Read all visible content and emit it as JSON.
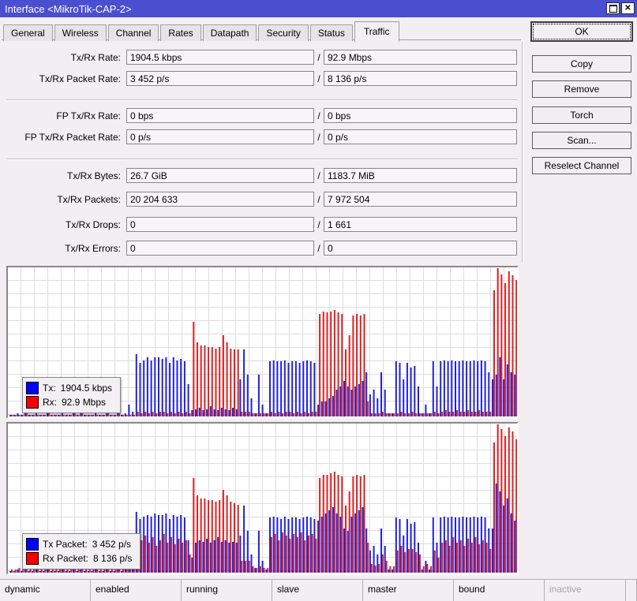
{
  "window": {
    "title": "Interface <MikroTik-CAP-2>"
  },
  "titlebar": {
    "buttons": [
      {
        "name": "maximize",
        "glyph": "max"
      },
      {
        "name": "close",
        "glyph": "x"
      }
    ]
  },
  "tabs": {
    "items": [
      "General",
      "Wireless",
      "Channel",
      "Rates",
      "Datapath",
      "Security",
      "Status",
      "Traffic"
    ],
    "active": "Traffic"
  },
  "fields": {
    "slash": "/",
    "rows": [
      {
        "id": "tx-rx-rate",
        "label": "Tx/Rx Rate:",
        "tx": "1904.5 kbps",
        "rx": "92.9 Mbps"
      },
      {
        "id": "tx-rx-packet-rate",
        "label": "Tx/Rx Packet Rate:",
        "tx": "3 452 p/s",
        "rx": "8 136 p/s"
      },
      {
        "id": "fp-tx-rx-rate",
        "label": "FP Tx/Rx Rate:",
        "tx": "0 bps",
        "rx": "0 bps"
      },
      {
        "id": "fp-tx-rx-packet-rate",
        "label": "FP Tx/Rx Packet Rate:",
        "tx": "0 p/s",
        "rx": "0 p/s"
      },
      {
        "id": "tx-rx-bytes",
        "label": "Tx/Rx Bytes:",
        "tx": "26.7 GiB",
        "rx": "1183.7 MiB"
      },
      {
        "id": "tx-rx-packets",
        "label": "Tx/Rx Packets:",
        "tx": "20 204 633",
        "rx": "7 972 504"
      },
      {
        "id": "tx-rx-drops",
        "label": "Tx/Rx Drops:",
        "tx": "0",
        "rx": "1 661"
      },
      {
        "id": "tx-rx-errors",
        "label": "Tx/Rx Errors:",
        "tx": "0",
        "rx": "0"
      }
    ]
  },
  "buttons": [
    {
      "id": "ok-button",
      "label": "OK",
      "default": true
    },
    {
      "id": "copy-button",
      "label": "Copy"
    },
    {
      "id": "remove-button",
      "label": "Remove"
    },
    {
      "id": "torch-button",
      "label": "Torch"
    },
    {
      "id": "scan-button",
      "label": "Scan..."
    },
    {
      "id": "reselect-channel-button",
      "label": "Reselect Channel"
    }
  ],
  "status_bar": {
    "items": [
      {
        "label": "dynamic",
        "muted": false
      },
      {
        "label": "enabled",
        "muted": false
      },
      {
        "label": "running",
        "muted": false
      },
      {
        "label": "slave",
        "muted": false
      },
      {
        "label": "master",
        "muted": false
      },
      {
        "label": "bound",
        "muted": false
      },
      {
        "label": "inactive",
        "muted": true
      }
    ]
  },
  "colors": {
    "titlebar": "#4a4fd0",
    "tx_bar": "#2222dd",
    "rx_bar": "#dd2222",
    "tx_swatch": "#0000f8",
    "rx_swatch": "#f80000"
  },
  "chart_data": [
    {
      "type": "bar",
      "name": "tx-rx-rate-graph",
      "title": "Traffic rate history (Tx blue / Rx red)",
      "ylim": [
        0,
        100
      ],
      "y_unit": "percent of plot height (no axis labels shown)",
      "grid": true,
      "legend_position": "bottom-left",
      "legend": [
        {
          "name": "tx",
          "label": "Tx:",
          "value": "1904.5 kbps",
          "color": "#0000f8"
        },
        {
          "name": "rx",
          "label": "Rx:",
          "value": "92.9 Mbps",
          "color": "#f80000"
        }
      ],
      "series": [
        {
          "name": "Tx",
          "color": "#2222dd",
          "values": [
            1,
            1,
            2,
            1,
            22,
            1,
            1,
            2,
            1,
            1,
            20,
            1,
            1,
            1,
            2,
            1,
            1,
            15,
            1,
            21,
            1,
            1,
            1,
            2,
            1,
            1,
            19,
            1,
            1,
            25,
            1,
            2,
            8,
            3,
            42,
            36,
            38,
            40,
            38,
            40,
            40,
            39,
            40,
            36,
            40,
            38,
            39,
            37,
            22,
            4,
            5,
            6,
            4,
            5,
            7,
            5,
            4,
            6,
            5,
            4,
            6,
            5,
            25,
            45,
            28,
            12,
            2,
            28,
            8,
            2,
            37,
            38,
            37,
            37,
            38,
            36,
            37,
            37,
            36,
            37,
            38,
            37,
            36,
            8,
            10,
            10,
            12,
            14,
            18,
            20,
            24,
            20,
            18,
            20,
            22,
            24,
            30,
            15,
            18,
            12,
            30,
            18,
            2,
            2,
            37,
            36,
            25,
            36,
            33,
            34,
            20,
            2,
            8,
            2,
            37,
            20,
            37,
            38,
            37,
            38,
            37,
            37,
            38,
            37,
            37,
            38,
            37,
            38,
            37,
            30,
            25,
            28,
            40,
            25,
            35,
            30,
            28
          ]
        },
        {
          "name": "Rx",
          "color": "#dd2222",
          "values": [
            1,
            1,
            1,
            1,
            2,
            1,
            1,
            1,
            1,
            1,
            2,
            1,
            1,
            1,
            1,
            1,
            1,
            2,
            1,
            2,
            1,
            1,
            1,
            1,
            1,
            1,
            2,
            1,
            1,
            2,
            1,
            1,
            1,
            1,
            3,
            2,
            3,
            2,
            3,
            2,
            3,
            3,
            2,
            3,
            2,
            3,
            2,
            3,
            2,
            64,
            50,
            48,
            48,
            47,
            47,
            46,
            47,
            55,
            50,
            46,
            45,
            45,
            3,
            3,
            3,
            2,
            2,
            2,
            2,
            2,
            3,
            2,
            3,
            2,
            3,
            3,
            2,
            3,
            2,
            3,
            2,
            3,
            3,
            69,
            71,
            70,
            71,
            72,
            70,
            69,
            45,
            55,
            68,
            69,
            68,
            69,
            10,
            2,
            2,
            2,
            3,
            2,
            2,
            2,
            2,
            3,
            2,
            2,
            3,
            2,
            2,
            2,
            2,
            2,
            3,
            2,
            3,
            4,
            3,
            3,
            4,
            3,
            3,
            4,
            3,
            3,
            4,
            3,
            3,
            3,
            85,
            100,
            96,
            90,
            98,
            95,
            92
          ]
        }
      ]
    },
    {
      "type": "bar",
      "name": "tx-rx-packet-rate-graph",
      "title": "Packet rate history (Tx blue / Rx red)",
      "ylim": [
        0,
        100
      ],
      "y_unit": "percent of plot height (no axis labels shown)",
      "grid": true,
      "legend_position": "bottom-left",
      "legend": [
        {
          "name": "tx-packet",
          "label": "Tx Packet:",
          "value": "3 452 p/s",
          "color": "#0000f8"
        },
        {
          "name": "rx-packet",
          "label": "Rx Packet:",
          "value": "8 136 p/s",
          "color": "#f80000"
        }
      ],
      "series": [
        {
          "name": "Tx Packet",
          "color": "#2222dd",
          "values": [
            1,
            1,
            2,
            1,
            22,
            1,
            1,
            2,
            1,
            1,
            20,
            1,
            1,
            1,
            2,
            1,
            1,
            15,
            1,
            21,
            1,
            1,
            1,
            2,
            1,
            1,
            19,
            1,
            1,
            25,
            1,
            2,
            8,
            3,
            41,
            36,
            38,
            39,
            38,
            40,
            39,
            39,
            40,
            36,
            39,
            38,
            39,
            37,
            22,
            10,
            20,
            22,
            21,
            23,
            20,
            22,
            24,
            21,
            22,
            20,
            21,
            20,
            25,
            45,
            28,
            12,
            3,
            28,
            8,
            2,
            37,
            38,
            37,
            36,
            38,
            36,
            37,
            37,
            36,
            37,
            38,
            37,
            36,
            35,
            38,
            40,
            42,
            44,
            40,
            38,
            30,
            28,
            38,
            40,
            42,
            44,
            30,
            15,
            18,
            12,
            30,
            18,
            2,
            2,
            37,
            36,
            25,
            36,
            33,
            34,
            20,
            2,
            8,
            2,
            37,
            20,
            37,
            38,
            37,
            38,
            37,
            37,
            38,
            37,
            37,
            38,
            37,
            38,
            37,
            30,
            30,
            60,
            55,
            45,
            50,
            40,
            35
          ]
        },
        {
          "name": "Rx Packet",
          "color": "#dd2222",
          "values": [
            2,
            2,
            3,
            2,
            3,
            2,
            2,
            3,
            2,
            2,
            3,
            2,
            2,
            2,
            3,
            2,
            2,
            3,
            2,
            3,
            2,
            2,
            2,
            3,
            2,
            2,
            3,
            2,
            2,
            3,
            2,
            2,
            2,
            2,
            18,
            22,
            25,
            20,
            24,
            18,
            22,
            26,
            20,
            24,
            19,
            23,
            20,
            22,
            12,
            64,
            52,
            50,
            50,
            49,
            49,
            48,
            49,
            56,
            52,
            48,
            47,
            46,
            8,
            8,
            8,
            4,
            3,
            4,
            3,
            3,
            24,
            26,
            22,
            27,
            25,
            23,
            26,
            24,
            27,
            22,
            25,
            26,
            23,
            64,
            66,
            66,
            67,
            68,
            66,
            65,
            45,
            55,
            65,
            66,
            65,
            66,
            20,
            6,
            5,
            6,
            12,
            8,
            4,
            4,
            15,
            18,
            14,
            16,
            16,
            14,
            12,
            4,
            6,
            4,
            15,
            10,
            20,
            22,
            18,
            24,
            20,
            22,
            18,
            23,
            20,
            24,
            19,
            22,
            20,
            16,
            88,
            100,
            97,
            92,
            98,
            95,
            90
          ]
        }
      ]
    }
  ]
}
